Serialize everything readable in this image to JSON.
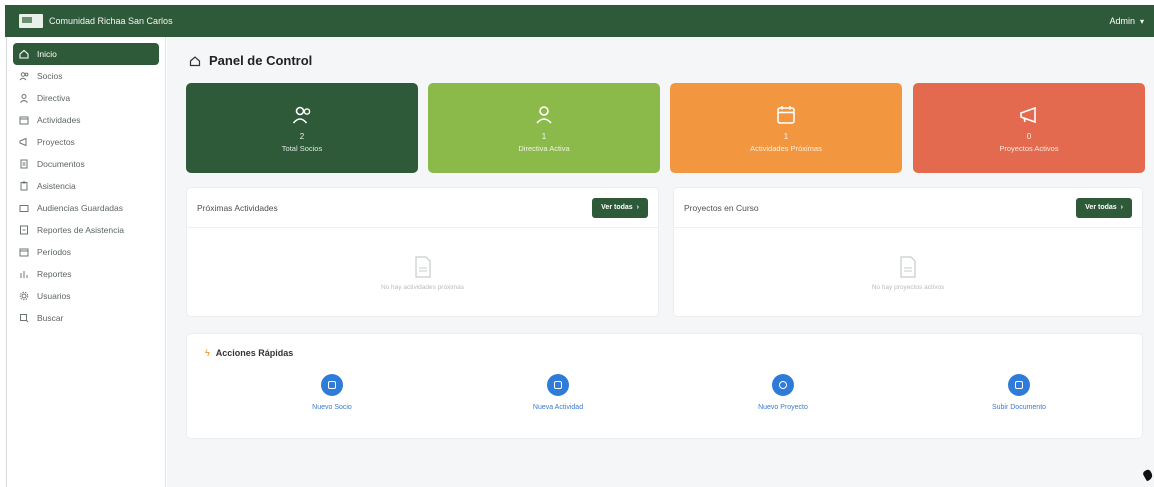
{
  "topbar": {
    "brand": "Comunidad Richaa San Carlos",
    "user": "Admin",
    "user_caret": "▾"
  },
  "sidebar": {
    "items": [
      {
        "label": "Inicio",
        "icon": "home-icon",
        "active": true
      },
      {
        "label": "Socios",
        "icon": "users-icon"
      },
      {
        "label": "Directiva",
        "icon": "user-icon"
      },
      {
        "label": "Actividades",
        "icon": "calendar-icon"
      },
      {
        "label": "Proyectos",
        "icon": "megaphone-icon"
      },
      {
        "label": "Documentos",
        "icon": "document-icon"
      },
      {
        "label": "Asistencia",
        "icon": "clipboard-icon"
      },
      {
        "label": "Audiencias Guardadas",
        "icon": "folder-icon"
      },
      {
        "label": "Reportes de Asistencia",
        "icon": "report-icon"
      },
      {
        "label": "Períodos",
        "icon": "calendar-icon"
      },
      {
        "label": "Reportes",
        "icon": "chart-icon"
      },
      {
        "label": "Usuarios",
        "icon": "gear-icon"
      },
      {
        "label": "Buscar",
        "icon": "search-icon"
      }
    ]
  },
  "main": {
    "title": "Panel de Control",
    "stats": [
      {
        "num": "2",
        "label": "Total Socios",
        "color": "#2f5a3a",
        "icon": "users-icon"
      },
      {
        "num": "1",
        "label": "Directiva Activa",
        "color": "#8cba4a",
        "icon": "user-icon"
      },
      {
        "num": "1",
        "label": "Actividades Próximas",
        "color": "#f29640",
        "icon": "calendar-icon"
      },
      {
        "num": "0",
        "label": "Proyectos Activos",
        "color": "#e46a4f",
        "icon": "megaphone-icon"
      }
    ],
    "activities": {
      "title": "Próximas Actividades",
      "button": "Ver todas",
      "button_arrow": "›",
      "empty": "No hay actividades próximas"
    },
    "projects": {
      "title": "Proyectos en Curso",
      "button": "Ver todas",
      "button_arrow": "›",
      "empty": "No hay proyectos activos"
    },
    "quick": {
      "title": "Acciones Rápidas",
      "bolt": "ϟ",
      "items": [
        {
          "label": "Nuevo Socio",
          "icon": "add-user-icon"
        },
        {
          "label": "Nueva Actividad",
          "icon": "calendar-icon"
        },
        {
          "label": "Nuevo Proyecto",
          "icon": "project-icon"
        },
        {
          "label": "Subir Documento",
          "icon": "upload-document-icon"
        }
      ]
    }
  },
  "colors": {
    "primary": "#2f5a3a",
    "accent_blue": "#2f7bd8"
  }
}
